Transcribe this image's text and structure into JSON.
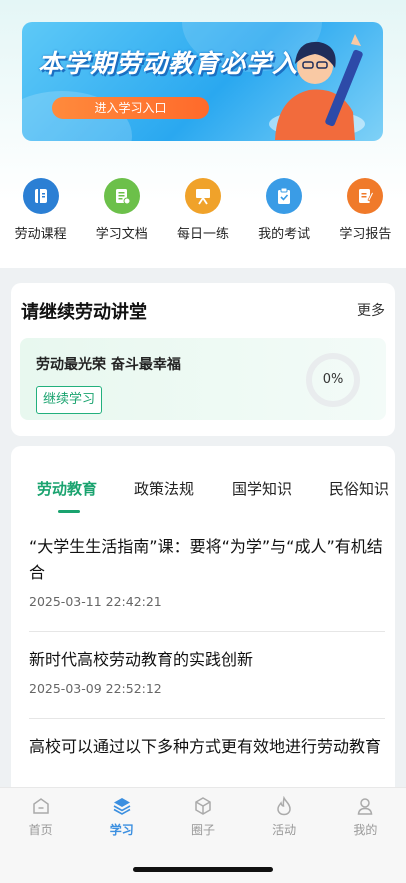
{
  "banner": {
    "title": "本学期劳动教育必学入口",
    "button_label": "进入学习入口"
  },
  "quick_nav": [
    {
      "label": "劳动课程",
      "icon": "book-icon",
      "color": "#2b7fd4"
    },
    {
      "label": "学习文档",
      "icon": "document-icon",
      "color": "#6cc04a"
    },
    {
      "label": "每日一练",
      "icon": "easel-icon",
      "color": "#f0a22a"
    },
    {
      "label": "我的考试",
      "icon": "clipboard-icon",
      "color": "#3a9ce6"
    },
    {
      "label": "学习报告",
      "icon": "report-icon",
      "color": "#f07a2a"
    }
  ],
  "lecture": {
    "title": "请继续劳动讲堂",
    "more": "更多",
    "course_name": "劳动最光荣  奋斗最幸福",
    "continue_label": "继续学习",
    "progress_text": "0%",
    "progress_value": 0
  },
  "tabs": [
    {
      "label": "劳动教育",
      "active": true
    },
    {
      "label": "政策法规",
      "active": false
    },
    {
      "label": "国学知识",
      "active": false
    },
    {
      "label": "民俗知识",
      "active": false
    }
  ],
  "articles": [
    {
      "title": "“大学生生活指南”课：要将“为学”与“成人”有机结合",
      "date": "2025-03-11 22:42:21"
    },
    {
      "title": "新时代高校劳动教育的实践创新",
      "date": "2025-03-09 22:52:12"
    },
    {
      "title": "高校可以通过以下多种方式更有效地进行劳动教育",
      "date": ""
    }
  ],
  "tabbar": [
    {
      "label": "首页",
      "icon": "home-icon",
      "active": false
    },
    {
      "label": "学习",
      "icon": "layers-icon",
      "active": true
    },
    {
      "label": "圈子",
      "icon": "cube-icon",
      "active": false
    },
    {
      "label": "活动",
      "icon": "flame-icon",
      "active": false
    },
    {
      "label": "我的",
      "icon": "user-icon",
      "active": false
    }
  ],
  "colors": {
    "accent_green": "#1aa36f",
    "tabbar_active": "#3b8fe0"
  }
}
